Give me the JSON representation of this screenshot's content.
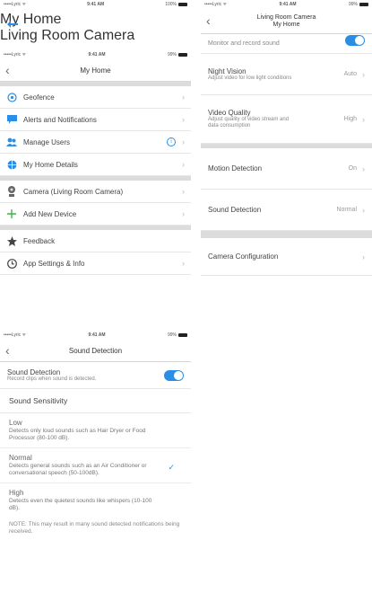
{
  "top_strip": {
    "carrier": "•••••Lyric ᯤ",
    "time": "9:41 AM",
    "battery": "100%",
    "title": "My Home",
    "subtitle": "Living Room Camera"
  },
  "my_home": {
    "status": {
      "carrier": "•••••Lyric ᯤ",
      "time": "9:41 AM",
      "battery": "99%"
    },
    "title": "My Home",
    "group1": [
      {
        "label": "Geofence",
        "icon": "geofence-icon"
      },
      {
        "label": "Alerts and Notifications",
        "icon": "chat-icon"
      },
      {
        "label": "Manage Users",
        "icon": "users-icon",
        "info": "i"
      },
      {
        "label": "My Home Details",
        "icon": "globe-icon"
      }
    ],
    "group2": [
      {
        "label": "Camera (Living Room Camera)",
        "icon": "camera-icon"
      },
      {
        "label": "Add New Device",
        "icon": "plus-icon"
      }
    ],
    "group3": [
      {
        "label": "Feedback",
        "icon": "star-icon"
      },
      {
        "label": "App Settings & Info",
        "icon": "clock-icon"
      }
    ]
  },
  "camera": {
    "status": {
      "carrier": "•••••Lyric ᯤ",
      "time": "9:41 AM",
      "battery": "99%"
    },
    "title": "Living Room Camera",
    "subtitle": "My Home",
    "monitor_text": "Monitor and record sound",
    "night_vision": {
      "title": "Night Vision",
      "desc": "Adjust video for low light conditions",
      "value": "Auto"
    },
    "video_quality": {
      "title": "Video Quality",
      "desc": "Adjust quality of video stream and data consumption",
      "value": "High"
    },
    "motion": {
      "title": "Motion Detection",
      "value": "On"
    },
    "sound": {
      "title": "Sound Detection",
      "value": "Normal"
    },
    "config": {
      "title": "Camera Configuration"
    }
  },
  "sound_detection": {
    "status": {
      "carrier": "•••••Lyric ᯤ",
      "time": "9:41 AM",
      "battery": "99%"
    },
    "title": "Sound Detection",
    "toggle_title": "Sound Detection",
    "toggle_desc": "Record clips when sound is detected.",
    "toggle_on": true,
    "section": "Sound Sensitivity",
    "options": [
      {
        "title": "Low",
        "desc": "Detects only loud sounds such as Hair Dryer or Food Processor (80-100 dB)."
      },
      {
        "title": "Normal",
        "desc": "Detects general sounds such as an Air Conditioner or conversational speech (50-100dB).",
        "selected": true
      },
      {
        "title": "High",
        "desc": "Detects even the quietest sounds like whispers (10-100 dB)."
      }
    ],
    "note": "NOTE: This may result in many sound detected notifications being received."
  },
  "colors": {
    "accent": "#2a8ee6",
    "separator": "#dcdcdc"
  }
}
